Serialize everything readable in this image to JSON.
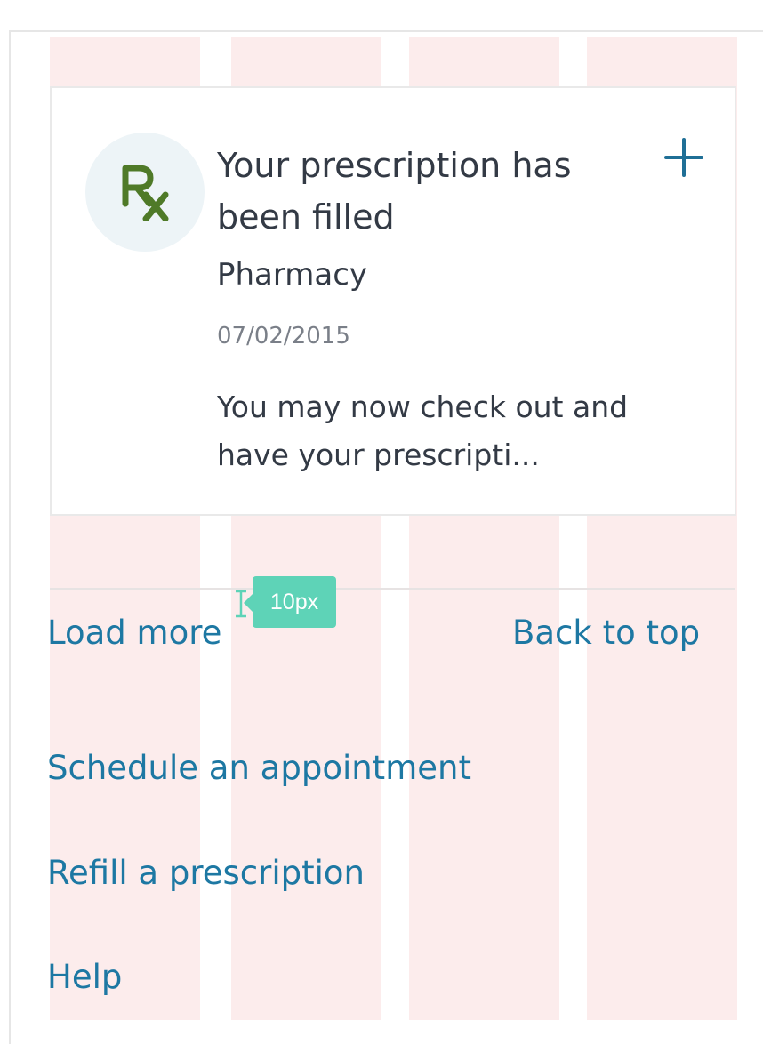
{
  "card": {
    "title": "Your prescription has been filled",
    "source": "Pharmacy",
    "date": "07/02/2015",
    "body": "You may now check out and have your prescripti...",
    "icon": "rx-icon",
    "action_icon": "plus-icon"
  },
  "footer": {
    "load_more": "Load more",
    "back_to_top": "Back to top"
  },
  "quick_links": {
    "schedule": "Schedule an appointment",
    "refill": "Refill a prescription",
    "help": "Help"
  },
  "measure_tooltip": {
    "label": "10px"
  },
  "colors": {
    "link": "#1d78a3",
    "rx_green": "#4f7a28",
    "plus_blue": "#1f6f96",
    "grid_overlay": "#fcecec",
    "tooltip": "#5ed3b7"
  }
}
